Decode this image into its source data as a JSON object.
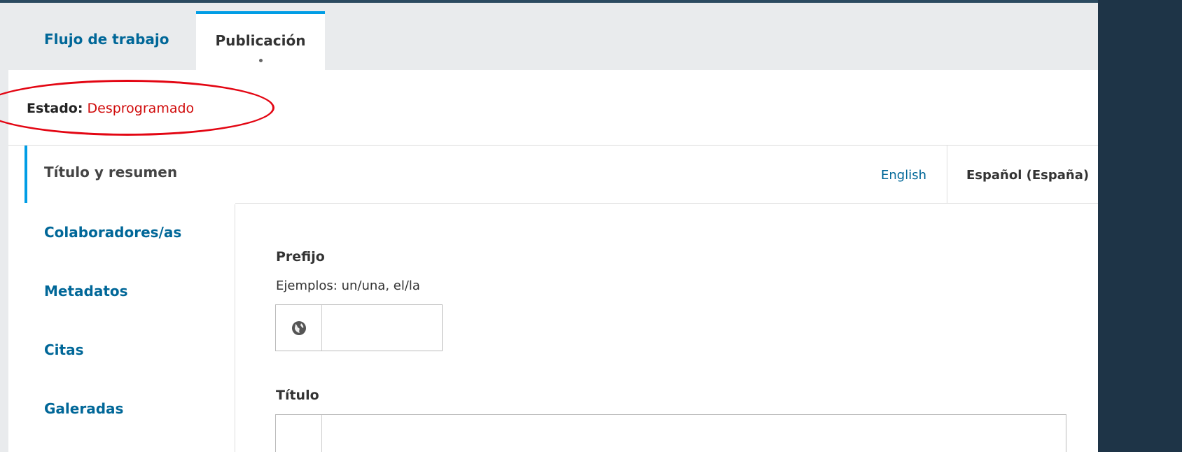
{
  "tabs": {
    "workflow": "Flujo de trabajo",
    "publication": "Publicación"
  },
  "status": {
    "label": "Estado:",
    "value": "Desprogramado"
  },
  "nav": {
    "items": [
      {
        "label": "Título y resumen",
        "active": true
      },
      {
        "label": "Colaboradores/as"
      },
      {
        "label": "Metadatos"
      },
      {
        "label": "Citas"
      },
      {
        "label": "Galeradas"
      }
    ]
  },
  "languages": {
    "english": "English",
    "spanish": "Español (España)"
  },
  "form": {
    "prefix": {
      "label": "Prefijo",
      "description": "Ejemplos: un/una, el/la",
      "value": ""
    },
    "title": {
      "label": "Título",
      "value": ""
    }
  },
  "colors": {
    "link": "#006798",
    "accent": "#009de5",
    "status": "#d00a0a",
    "annotation": "#e30613"
  },
  "icons": {
    "locale": "globe-icon"
  }
}
